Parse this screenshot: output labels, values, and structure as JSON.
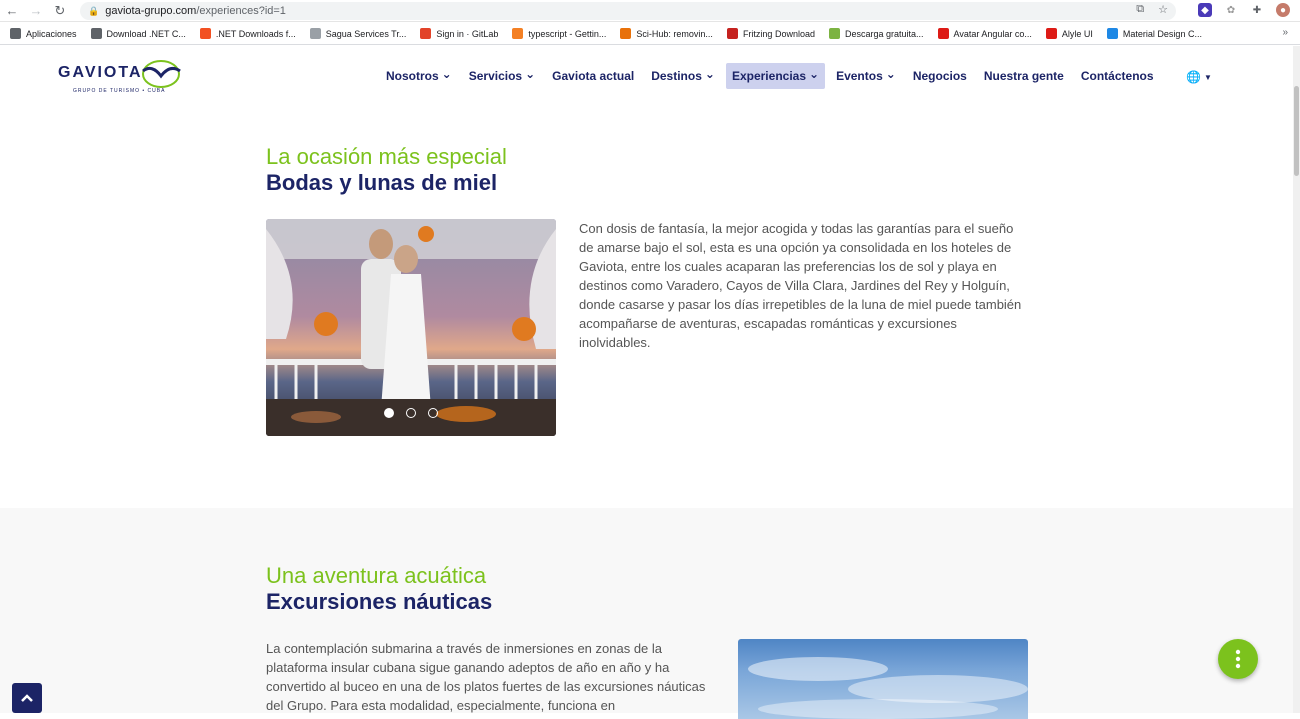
{
  "browser": {
    "url_host": "gaviota-grupo.com",
    "url_path": "/experiences?id=1",
    "bookmarks": [
      {
        "label": "Aplicaciones",
        "icon": "apps-grid-icon",
        "color": "#5f6368"
      },
      {
        "label": "Download .NET C...",
        "icon": "globe-icon",
        "color": "#5f6368"
      },
      {
        "label": ".NET Downloads f...",
        "icon": "microsoft-icon",
        "color": "#f25022"
      },
      {
        "label": "Sagua Services Tr...",
        "icon": "bird-icon",
        "color": "#9aa0a6"
      },
      {
        "label": "Sign in · GitLab",
        "icon": "gitlab-icon",
        "color": "#e24329"
      },
      {
        "label": "typescript - Gettin...",
        "icon": "stackoverflow-icon",
        "color": "#f48024"
      },
      {
        "label": "Sci-Hub: removin...",
        "icon": "scihub-icon",
        "color": "#e8710a"
      },
      {
        "label": "Fritzing Download",
        "icon": "fritzing-icon",
        "color": "#c5221f"
      },
      {
        "label": "Descarga gratuita...",
        "icon": "download-arrow-icon",
        "color": "#7cb342"
      },
      {
        "label": "Avatar Angular co...",
        "icon": "angular-icon",
        "color": "#dd1b16"
      },
      {
        "label": "Alyle UI",
        "icon": "angular-icon",
        "color": "#dd1b16"
      },
      {
        "label": "Material Design C...",
        "icon": "material-icon",
        "color": "#1e88e5"
      }
    ],
    "bookmarks_more": "»"
  },
  "header": {
    "logo_text": "GAVIOTA",
    "logo_subtitle": "GRUPO DE TURISMO • CUBA",
    "menu": [
      {
        "label": "Nosotros",
        "dropdown": true,
        "active": false
      },
      {
        "label": "Servicios",
        "dropdown": true,
        "active": false
      },
      {
        "label": "Gaviota actual",
        "dropdown": false,
        "active": false
      },
      {
        "label": "Destinos",
        "dropdown": true,
        "active": false
      },
      {
        "label": "Experiencias",
        "dropdown": true,
        "active": true
      },
      {
        "label": "Eventos",
        "dropdown": true,
        "active": false
      },
      {
        "label": "Negocios",
        "dropdown": false,
        "active": false
      },
      {
        "label": "Nuestra gente",
        "dropdown": false,
        "active": false
      },
      {
        "label": "Contáctenos",
        "dropdown": false,
        "active": false
      }
    ],
    "language_icon": "globe-icon"
  },
  "section1": {
    "kicker": "La ocasión más especial",
    "title": "Bodas y lunas de miel",
    "body": "Con dosis de fantasía, la mejor acogida y todas las garantías para el sueño de amarse bajo el sol, esta es una opción ya consolidada en los hoteles de Gaviota, entre los cuales acaparan las preferencias los de sol y playa en destinos como Varadero, Cayos de Villa Clara, Jardines del Rey y Holguín, donde casarse y pasar los días irrepetibles de la luna de miel puede también acompañarse de aventuras, escapadas románticas y excursiones inolvidables.",
    "carousel_dots": 3,
    "carousel_active": 1
  },
  "section2": {
    "kicker": "Una aventura acuática",
    "title": "Excursiones náuticas",
    "body": "La contemplación submarina a través de inmersiones en zonas de la plataforma insular cubana sigue ganando adeptos de año en año y ha convertido al buceo en una de los platos fuertes de las excursiones náuticas del Grupo. Para esta modalidad, especialmente, funciona en"
  },
  "colors": {
    "brand_navy": "#1c2466",
    "brand_green": "#7cc21d",
    "menu_active_bg": "#cdd1ee"
  }
}
